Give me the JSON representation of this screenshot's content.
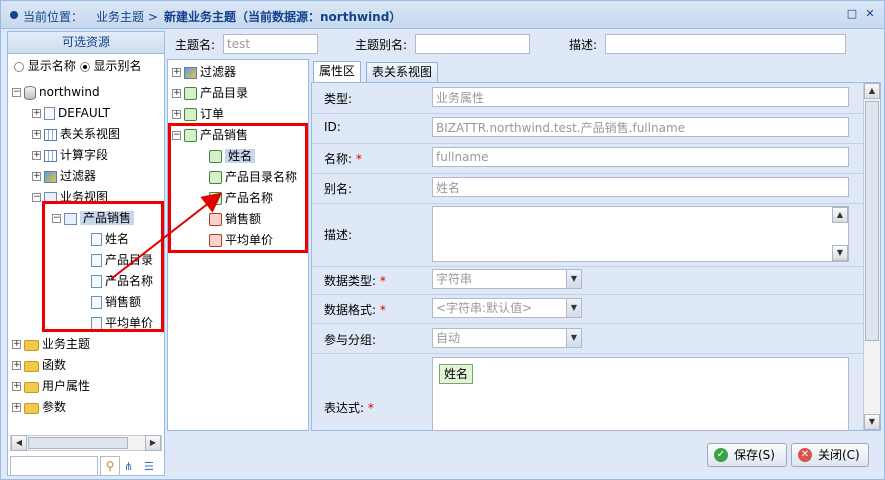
{
  "title": {
    "location_label": "当前位置：",
    "location_path": "业务主题 >",
    "window_title": "新建业务主题（当前数据源：northwind）"
  },
  "left_panel": {
    "header": "可选资源",
    "radio_show_name": "显示名称",
    "radio_show_alias": "显示别名",
    "selected_radio": "显示别名",
    "tree": {
      "root": "northwind",
      "nodes": [
        "DEFAULT",
        "表关系视图",
        "计算字段",
        "过滤器",
        "业务视图"
      ],
      "view_name": "产品销售",
      "fields": [
        "姓名",
        "产品目录",
        "产品名称",
        "销售额",
        "平均单价"
      ],
      "bottom_nodes": [
        "业务主题",
        "函数",
        "用户属性",
        "参数"
      ]
    }
  },
  "top_form": {
    "theme_name_label": "主题名:",
    "theme_name_value": "test",
    "theme_alias_label": "主题别名:",
    "theme_alias_value": "",
    "desc_label": "描述:",
    "desc_value": ""
  },
  "middle_tree": {
    "nodes": [
      "过滤器",
      "产品目录",
      "订单"
    ],
    "group": "产品销售",
    "fields": [
      "姓名",
      "产品目录名称",
      "产品名称",
      "销售额",
      "平均单价"
    ]
  },
  "tabs": [
    "属性区",
    "表关系视图"
  ],
  "properties": {
    "type_label": "类型:",
    "type_value": "业务属性",
    "id_label": "ID:",
    "id_value": "BIZATTR.northwind.test.产品销售.fullname",
    "name_label": "名称:",
    "name_value": "fullname",
    "alias_label": "别名:",
    "alias_value": "姓名",
    "desc_label": "描述:",
    "datatype_label": "数据类型:",
    "datatype_value": "字符串",
    "format_label": "数据格式:",
    "format_value": "<字符串:默认值>",
    "group_label": "参与分组:",
    "group_value": "自动",
    "expr_label": "表达式:",
    "expr_token": "姓名",
    "required_mark": "*"
  },
  "buttons": {
    "save": "保存(S)",
    "close": "关闭(C)"
  },
  "search": {
    "value": ""
  },
  "colors": {
    "highlight": "#e00000",
    "title_text": "#15428b",
    "border": "#99bbe8"
  }
}
